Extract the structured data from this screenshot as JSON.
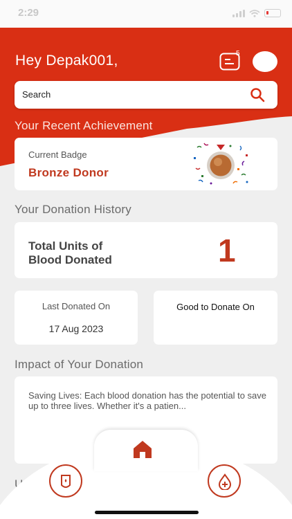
{
  "status_bar": {
    "time": "2:29"
  },
  "header": {
    "greeting": "Hey Depak001,",
    "notification_count": "5"
  },
  "search": {
    "placeholder": "Search"
  },
  "achievement": {
    "section_title": "Your Recent Achievement",
    "badge_label": "Current Badge",
    "badge_name": "Bronze Donor",
    "medal_icon": "bronze-medal-confetti"
  },
  "history": {
    "section_title": "Your Donation History",
    "total_label": "Total Units of Blood Donated",
    "total_value": "1",
    "last_label": "Last Donated On",
    "last_date": "17 Aug 2023",
    "good_label": "Good to Donate On"
  },
  "impact": {
    "section_title": "Impact of Your Donation",
    "text": "Saving Lives: Each blood donation has the potential to save up to three lives. Whether it's a patien..."
  },
  "peek_title": "U",
  "nav": {
    "left_icon": "blood-bag-icon",
    "home_icon": "home-icon",
    "right_icon": "blood-drop-plus-icon"
  },
  "colors": {
    "brand_red": "#c0391f",
    "header_red": "#d92f14",
    "background": "#efefef"
  }
}
